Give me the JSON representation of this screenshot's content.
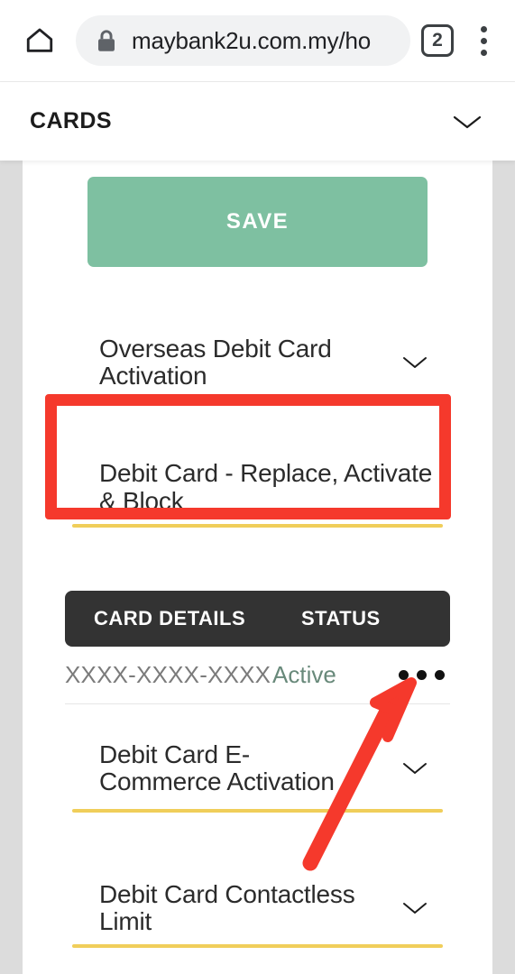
{
  "browser": {
    "home_icon": "home-icon",
    "lock_icon": "lock-icon",
    "url_visible": "maybank2u.com.my/ho",
    "url_full": "maybank2u.com.my/ho",
    "tab_count": "2",
    "menu_icon": "kebab-menu-icon"
  },
  "site_header": {
    "title": "CARDS",
    "chevron_icon": "chevron-down-icon"
  },
  "main": {
    "save_label": "SAVE",
    "accordions": [
      {
        "label": "Overseas Debit Card Activation",
        "chevron_icon": "chevron-down-icon"
      },
      {
        "label": "Debit Card - Replace, Activate & Block",
        "chevron_icon": "none"
      },
      {
        "label": "Debit Card E-Commerce Activation",
        "chevron_icon": "chevron-down-icon"
      },
      {
        "label": "Debit Card Contactless Limit",
        "chevron_icon": "chevron-down-icon"
      }
    ],
    "card_table": {
      "columns": [
        "CARD DETAILS",
        "STATUS"
      ],
      "rows": [
        {
          "card_details": "XXXX-XXXX-XXXX",
          "status": "Active",
          "menu_icon": "overflow-menu-icon"
        }
      ]
    }
  },
  "annotations": {
    "highlight_box": {
      "target": "Debit Card - Replace, Activate & Block",
      "color": "#f5392c"
    },
    "arrow": {
      "target": "overflow-menu-icon",
      "color": "#f5392c"
    }
  },
  "colors": {
    "save_green": "#7ec0a1",
    "divider_gold": "#f0ce5a",
    "table_header_dark": "#333333",
    "status_active": "#68897a",
    "annotation_red": "#f5392c"
  }
}
